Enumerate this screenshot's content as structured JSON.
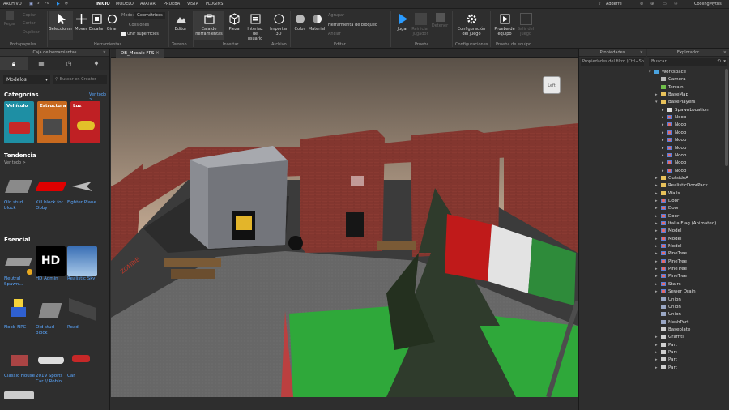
{
  "menu": {
    "file": "ARCHIVO",
    "tabs": [
      "INICIO",
      "MODELO",
      "AVATAR",
      "PRUEBA",
      "VISTA",
      "PLUGINS"
    ],
    "active": "INICIO"
  },
  "user": {
    "share": "Adderre",
    "name": "CoolingMyths"
  },
  "ribbon": {
    "clipboard": {
      "paste": "Pegar",
      "copy": "Copiar",
      "cut": "Cortar",
      "duplicate": "Duplicar",
      "group": "Portapapeles"
    },
    "tools": {
      "select": "Seleccionar",
      "move": "Mover",
      "scale": "Escalar",
      "rotate": "Girar",
      "mode_label": "Modo:",
      "mode_value": "Geométricos",
      "collisions": "Colisiones",
      "join": "Unir superficies",
      "group": "Herramientas"
    },
    "terrain": {
      "editor": "Editor",
      "group": "Terreno"
    },
    "insert": {
      "toolbox": "Caja de herramientas",
      "part": "Pieza",
      "ui": "Interfaz de usuario",
      "import3d": "Importar 3D",
      "group": "Insertar"
    },
    "file": {
      "group": "Archivo"
    },
    "edit": {
      "color": "Color",
      "material": "Material",
      "group_btn": "Agrupar",
      "lock": "Bloquear",
      "anchor": "Anclar",
      "lock_tool": "Herramienta de bloqueo",
      "group": "Editar"
    },
    "test": {
      "play": "Jugar",
      "reset": "Reiniciar jugador",
      "stop": "Detener",
      "group": "Prueba"
    },
    "settings": {
      "game_settings": "Configuración del juego",
      "group": "Configuraciones"
    },
    "team": {
      "team_test": "Prueba de equipo",
      "exit": "Salir del juego",
      "group": "Prueba de equipo"
    }
  },
  "toolbox": {
    "title": "Caja de herramientas",
    "category_select": "Modelos",
    "search_placeholder": "Buscar en Creator",
    "categories_title": "Categorías",
    "see_all": "Ver todo >",
    "categories": [
      "Vehículo",
      "Estructura",
      "Luz"
    ],
    "trending_title": "Tendencia",
    "trending_see_all": "Ver todo >",
    "trending": [
      "Old stud block",
      "Kill block for Obby",
      "Fighter Plane"
    ],
    "essential_title": "Esencial",
    "essential": [
      "Neutral Spawn...",
      "HD Admin",
      "Realistic Sky",
      "Noob NPC",
      "Old stud block",
      "Road",
      "Classic House",
      "2019 Sports Car // Roblo",
      "Car"
    ],
    "hd_text": "HD"
  },
  "viewport": {
    "tab": "DB_Mosaic FPS",
    "cube_label": "Left",
    "wall_text": "ZOMBIE"
  },
  "properties": {
    "title": "Propiedades",
    "filter_placeholder": "Propiedades del filtro (Ctrl+Shift+P)"
  },
  "explorer": {
    "title": "Explorador",
    "search_placeholder": "Buscar",
    "items": [
      {
        "label": "Workspace",
        "level": 0,
        "arrow": "down",
        "icon": "workspace"
      },
      {
        "label": "Camera",
        "level": 1,
        "arrow": "",
        "icon": "camera"
      },
      {
        "label": "Terrain",
        "level": 1,
        "arrow": "",
        "icon": "terrain"
      },
      {
        "label": "BaseMap",
        "level": 1,
        "arrow": "right",
        "icon": "folder"
      },
      {
        "label": "BasePlayers",
        "level": 1,
        "arrow": "down",
        "icon": "folder"
      },
      {
        "label": "SpawnLocation",
        "level": 2,
        "arrow": "right",
        "icon": "spawn"
      },
      {
        "label": "Noob",
        "level": 2,
        "arrow": "right",
        "icon": "model"
      },
      {
        "label": "Noob",
        "level": 2,
        "arrow": "right",
        "icon": "model"
      },
      {
        "label": "Noob",
        "level": 2,
        "arrow": "right",
        "icon": "model"
      },
      {
        "label": "Noob",
        "level": 2,
        "arrow": "right",
        "icon": "model"
      },
      {
        "label": "Noob",
        "level": 2,
        "arrow": "right",
        "icon": "model"
      },
      {
        "label": "Noob",
        "level": 2,
        "arrow": "right",
        "icon": "model"
      },
      {
        "label": "Noob",
        "level": 2,
        "arrow": "right",
        "icon": "model"
      },
      {
        "label": "Noob",
        "level": 2,
        "arrow": "right",
        "icon": "model"
      },
      {
        "label": "OutsideA",
        "level": 1,
        "arrow": "right",
        "icon": "folder"
      },
      {
        "label": "RealisticDoorPack",
        "level": 1,
        "arrow": "right",
        "icon": "folder"
      },
      {
        "label": "Walls",
        "level": 1,
        "arrow": "right",
        "icon": "folder"
      },
      {
        "label": "Door",
        "level": 1,
        "arrow": "right",
        "icon": "model"
      },
      {
        "label": "Door",
        "level": 1,
        "arrow": "right",
        "icon": "model"
      },
      {
        "label": "Door",
        "level": 1,
        "arrow": "right",
        "icon": "model"
      },
      {
        "label": "Italia Flag (Animated)",
        "level": 1,
        "arrow": "right",
        "icon": "model"
      },
      {
        "label": "Model",
        "level": 1,
        "arrow": "right",
        "icon": "model"
      },
      {
        "label": "Model",
        "level": 1,
        "arrow": "right",
        "icon": "model"
      },
      {
        "label": "Model",
        "level": 1,
        "arrow": "right",
        "icon": "model"
      },
      {
        "label": "PineTree",
        "level": 1,
        "arrow": "right",
        "icon": "model"
      },
      {
        "label": "PineTree",
        "level": 1,
        "arrow": "right",
        "icon": "model"
      },
      {
        "label": "PineTree",
        "level": 1,
        "arrow": "right",
        "icon": "model"
      },
      {
        "label": "PineTree",
        "level": 1,
        "arrow": "right",
        "icon": "model"
      },
      {
        "label": "Stairs",
        "level": 1,
        "arrow": "right",
        "icon": "model"
      },
      {
        "label": "Sewer Drain",
        "level": 1,
        "arrow": "right",
        "icon": "model"
      },
      {
        "label": "Union",
        "level": 1,
        "arrow": "",
        "icon": "union"
      },
      {
        "label": "Union",
        "level": 1,
        "arrow": "",
        "icon": "union"
      },
      {
        "label": "Union",
        "level": 1,
        "arrow": "",
        "icon": "union"
      },
      {
        "label": "MeshPart",
        "level": 1,
        "arrow": "",
        "icon": "mesh"
      },
      {
        "label": "Baseplate",
        "level": 1,
        "arrow": "",
        "icon": "part"
      },
      {
        "label": "Graffiti",
        "level": 1,
        "arrow": "right",
        "icon": "part"
      },
      {
        "label": "Part",
        "level": 1,
        "arrow": "right",
        "icon": "part"
      },
      {
        "label": "Part",
        "level": 1,
        "arrow": "right",
        "icon": "part"
      },
      {
        "label": "Part",
        "level": 1,
        "arrow": "right",
        "icon": "part"
      },
      {
        "label": "Part",
        "level": 1,
        "arrow": "right",
        "icon": "part"
      }
    ]
  },
  "colors": {
    "accent": "#00a2ff",
    "link": "#5aa7ff",
    "panel": "#2e2e2e",
    "header": "#353535"
  }
}
